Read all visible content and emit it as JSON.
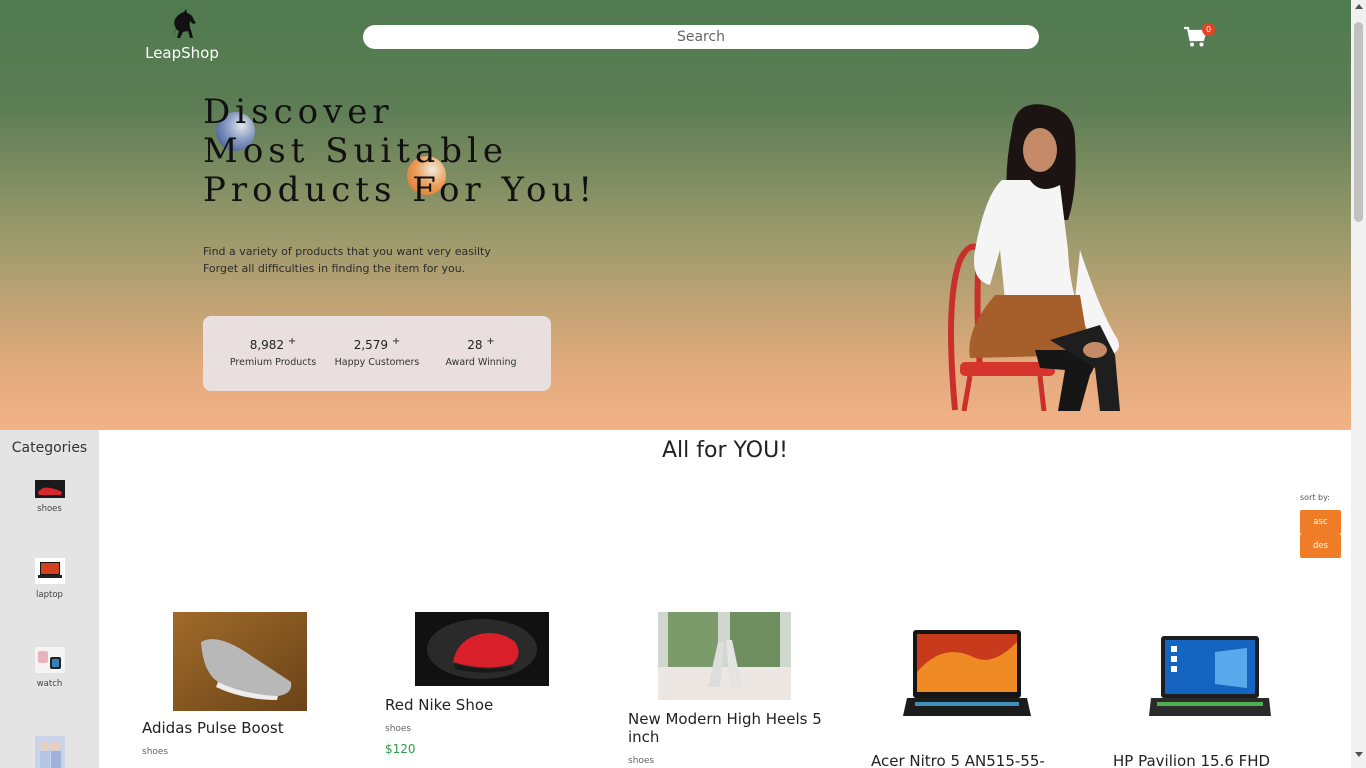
{
  "header": {
    "brand": "LeapShop",
    "search_placeholder": "Search",
    "cart_count": "0"
  },
  "hero": {
    "headline": [
      "Discover",
      "Most Suitable",
      "Products For You!"
    ],
    "subtitle": [
      "Find a variety of products that you want very easilty",
      "Forget all difficulties in finding the item for you."
    ],
    "stats": [
      {
        "value": "8,982",
        "plus": "+",
        "label": "Premium Products"
      },
      {
        "value": "2,579",
        "plus": "+",
        "label": "Happy Customers"
      },
      {
        "value": "28",
        "plus": "+",
        "label": "Award Winning"
      }
    ]
  },
  "sidebar": {
    "title": "Categories",
    "items": [
      {
        "label": "shoes"
      },
      {
        "label": "laptop"
      },
      {
        "label": "watch"
      }
    ]
  },
  "main": {
    "title": "All for YOU!",
    "sort": {
      "label": "sort by:",
      "asc": "asc",
      "des": "des"
    },
    "products": [
      {
        "name": "Adidas Pulse Boost",
        "category": "shoes",
        "price": ""
      },
      {
        "name": "Red Nike Shoe",
        "category": "shoes",
        "price": "$120"
      },
      {
        "name": "New Modern High Heels 5 inch",
        "category": "shoes",
        "price": ""
      },
      {
        "name": "Acer Nitro 5 AN515-55-",
        "category": "",
        "price": ""
      },
      {
        "name": "HP Pavilion 15.6 FHD",
        "category": "",
        "price": ""
      }
    ]
  },
  "colors": {
    "accent": "#ef7c27",
    "badge": "#e8421f",
    "price": "#2f9c4a",
    "hero_top": "#4f7a4f",
    "hero_bottom": "#f2b287"
  }
}
